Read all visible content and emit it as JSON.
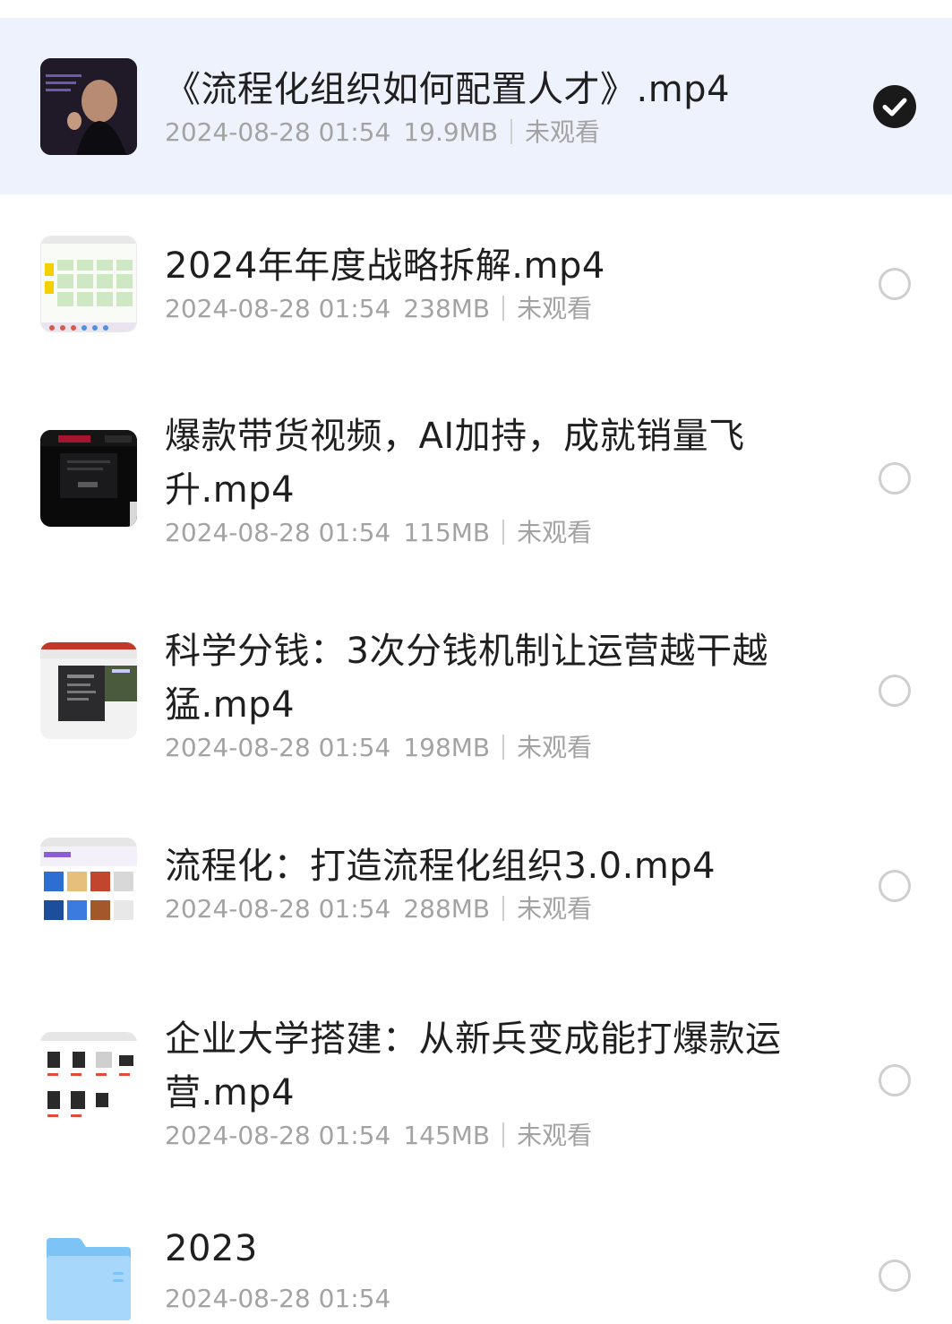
{
  "files": [
    {
      "title": "《流程化组织如何配置人才》.mp4",
      "date": "2024-08-28 01:54",
      "size": "19.9MB",
      "status": "未观看",
      "selected": true
    },
    {
      "title": "2024年年度战略拆解.mp4",
      "date": "2024-08-28 01:54",
      "size": "238MB",
      "status": "未观看",
      "selected": false
    },
    {
      "title": "爆款带货视频，AI加持，成就销量飞升.mp4",
      "date": "2024-08-28 01:54",
      "size": "115MB",
      "status": "未观看",
      "selected": false
    },
    {
      "title": "科学分钱：3次分钱机制让运营越干越猛.mp4",
      "date": "2024-08-28 01:54",
      "size": "198MB",
      "status": "未观看",
      "selected": false
    },
    {
      "title": "流程化：打造流程化组织3.0.mp4",
      "date": "2024-08-28 01:54",
      "size": "288MB",
      "status": "未观看",
      "selected": false
    },
    {
      "title": "企业大学搭建：从新兵变成能打爆款运营.mp4",
      "date": "2024-08-28 01:54",
      "size": "145MB",
      "status": "未观看",
      "selected": false
    }
  ],
  "folder": {
    "title": "2023",
    "date": "2024-08-28 01:54",
    "selected": false
  },
  "icons": {
    "selected": "check-circle-icon",
    "unselected": "empty-radio-icon",
    "folder": "folder-icon"
  },
  "colors": {
    "selected_row_bg": "#eef2fd",
    "title": "#1f1f1f",
    "meta": "#a3a3a3",
    "check_fill": "#1a1a1a",
    "radio_border": "#cfcfcf",
    "folder_blue": "#7ec3f5"
  }
}
